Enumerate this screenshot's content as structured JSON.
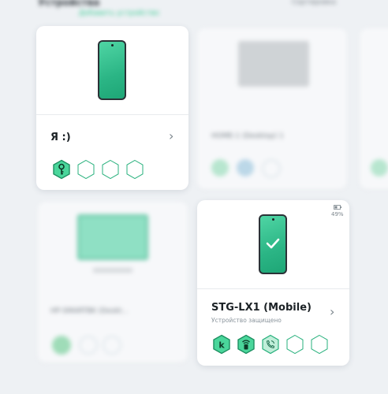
{
  "header": {
    "title": "Устройства",
    "link": "Добавить устройство",
    "right": "Сортировка"
  },
  "card1": {
    "title": "Я :)",
    "chevron": "›"
  },
  "card2": {
    "title": "STG-LX1 (Mobile)",
    "subtitle": "Устройство защищено",
    "battery": "49%",
    "chevron": "›"
  },
  "bg_cards": {
    "desktop_title": "HOME-1 (Desktop) 1",
    "tv_title": "HP-SMARTBK (Deskt..."
  },
  "colors": {
    "accent": "#2fc98e",
    "hex_border": "#27b07c",
    "hex_fill_active": "#4ad69b",
    "hex_icon": "#0e3a28"
  },
  "icons": [
    "key-icon",
    "kaspersky-k-icon",
    "wifi-shield-icon",
    "call-filter-icon",
    "empty-hexagon-icon"
  ]
}
